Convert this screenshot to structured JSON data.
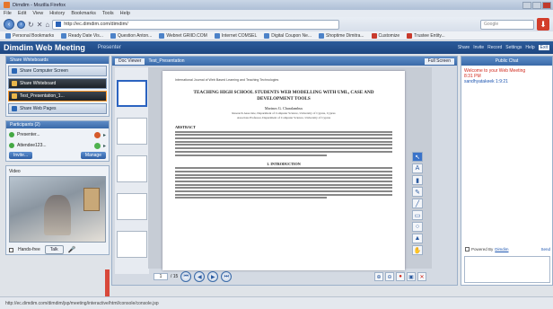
{
  "window": {
    "title": "Dimdim - Mozilla Firefox"
  },
  "menu": [
    "File",
    "Edit",
    "View",
    "History",
    "Bookmarks",
    "Tools",
    "Help"
  ],
  "nav": {
    "url": "http://ec.dimdim.com/dimdim/",
    "search_placeholder": "Google"
  },
  "bookmarks": [
    {
      "label": "Personal Bookmarks",
      "style": "blue"
    },
    {
      "label": "Ready Date Vis...",
      "style": "blue"
    },
    {
      "label": "Question Anton...",
      "style": "blue"
    },
    {
      "label": "Webnet GRIID.COM",
      "style": "blue"
    },
    {
      "label": "Internet COMSEL",
      "style": "blue"
    },
    {
      "label": "Digital Coupon Ne...",
      "style": "blue"
    },
    {
      "label": "Shoptime Dimitra...",
      "style": "blue"
    },
    {
      "label": "Customize",
      "style": "red"
    },
    {
      "label": "Trustee Entity...",
      "style": "red"
    }
  ],
  "app": {
    "title": "Dimdim Web Meeting",
    "subtitle": "Presenter",
    "header_right": [
      "Share",
      "Invite",
      "Record",
      "Settings",
      "Help"
    ],
    "header_badge": "Exit"
  },
  "left": {
    "share_panel_title": "Share Whiteboards",
    "items": [
      {
        "label": "Share Computer Screen",
        "active": false,
        "highlight": false
      },
      {
        "label": "Share Whiteboard",
        "active": true,
        "highlight": false
      },
      {
        "label": "Test_Presentation_1...",
        "active": true,
        "highlight": true
      },
      {
        "label": "Share Web Pages",
        "active": false,
        "highlight": false
      }
    ],
    "participants_title": "Participants (2)",
    "participants": [
      {
        "name": "Presenter...",
        "mic": "red"
      },
      {
        "name": "Attendee123...",
        "mic": "green"
      }
    ],
    "invite_label": "Invite...",
    "manage_label": "Manage",
    "video_title": "Video",
    "handsfree_label": "Hands-free",
    "talk_label": "Talk"
  },
  "doc": {
    "toolbar_sel": "Doc Viewer",
    "toolbar_title": "Test_Presentation",
    "toolbar_right": "Full Screen",
    "thumb_numbers": [
      "1",
      "2",
      "3",
      "4",
      "5"
    ],
    "page_header": "International Journal of Web Based Learning and Teaching Technologies",
    "page_title": "TEACHING HIGH SCHOOL STUDENTS WEB MODELLING WITH UML, CASE AND DEVELOPMENT TOOLS",
    "author": "Marinos G. Charalambus",
    "affil_1": "Research Associate, Department of Computer Science, University of Cyprus, Cyprus",
    "affil_2": "Associate Professor, Department of Computer Science, University of Cyprus",
    "abstract_heading": "ABSTRACT",
    "intro_heading": "1.  INTRODUCTION",
    "page_field": "1",
    "page_total": "/ 15"
  },
  "chat": {
    "title": "Public Chat",
    "welcome": "Welcome to your Web Meeting",
    "time": "8:31 PM",
    "who": "sandhyatakeek 1:9:21",
    "powered_prefix": "Powered By",
    "powered_link": "Dimdim",
    "powered_right": "Send"
  },
  "status": {
    "text": "http://ec.dimdim.com/dimdim/jsp/meeting/interactive/html/console/console.jsp"
  }
}
